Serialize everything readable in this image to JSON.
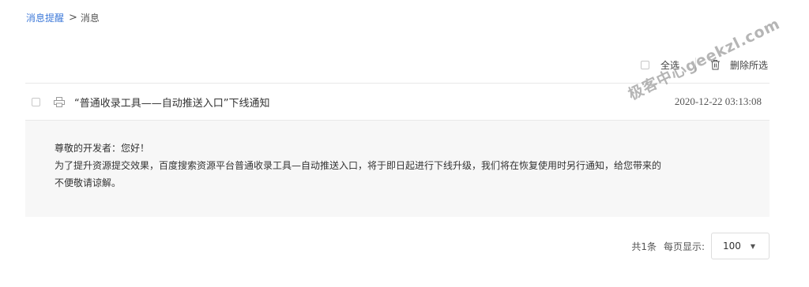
{
  "breadcrumb": {
    "parent": "消息提醒",
    "separator": ">",
    "current": "消息"
  },
  "toolbar": {
    "select_all_label": "全选",
    "delete_selected_label": "删除所选"
  },
  "message": {
    "title": "“普通收录工具——自动推送入口”下线通知",
    "time": "2020-12-22 03:13:08",
    "body": {
      "greeting": "尊敬的开发者：您好！",
      "line1": "为了提升资源提交效果，百度搜索资源平台普通收录工具—自动推送入口，将于即日起进行下线升级，我们将在恢复使用时另行通知，给您带来的",
      "line2": "不便敬请谅解。"
    }
  },
  "watermark": "极客中心geekzl.com",
  "pagination": {
    "total": "共1条",
    "per_page_label": "每页显示:",
    "per_page_value": "100"
  },
  "icons": {
    "trash": "trash-icon",
    "printer": "printer-icon",
    "caret": "caret-down-icon"
  },
  "colors": {
    "link": "#3f7ad9",
    "body_bg": "#f7f7f7",
    "border": "#e8e8e8"
  }
}
